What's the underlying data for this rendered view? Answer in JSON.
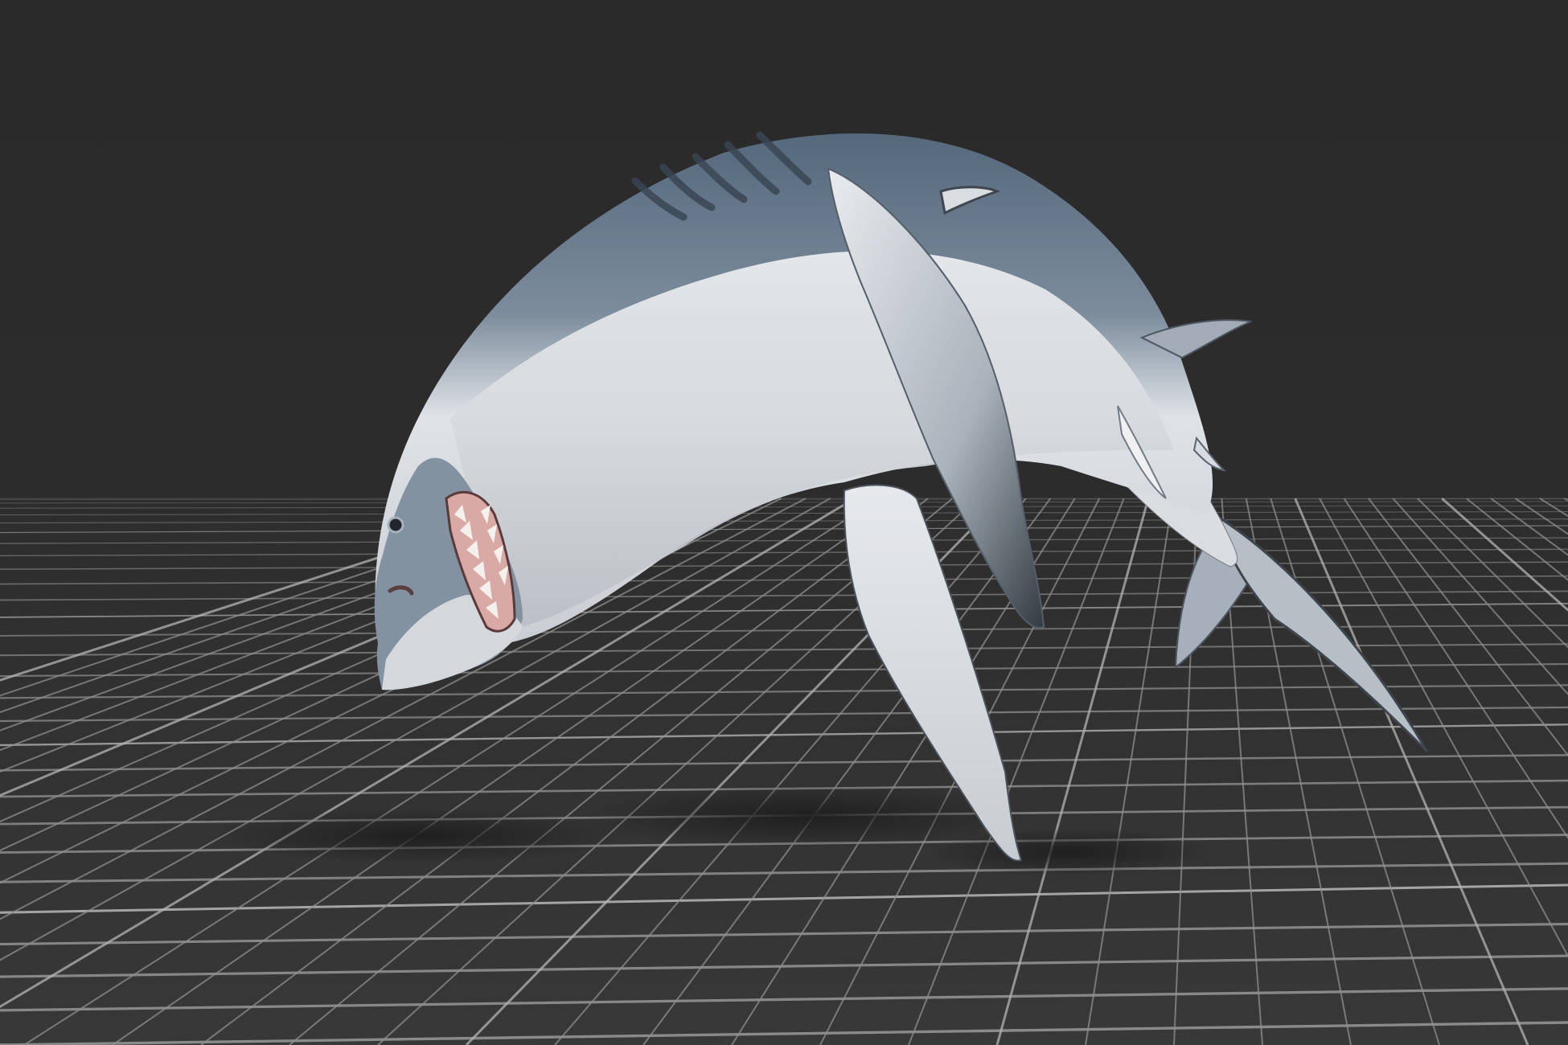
{
  "viewport": {
    "background_color": "#2b2b2b",
    "floor_color": "#363636",
    "grid_line_color": "#8f8f8f",
    "grid_major_line_color": "#b4b4b4",
    "grid_visible": true
  },
  "model": {
    "subject_icon": "shark-model",
    "dorsal_color": "#5f7286",
    "belly_color": "#e4e7ea",
    "fin_shadow_color": "#3b4148",
    "mouth_color": "#d9a9a6"
  }
}
